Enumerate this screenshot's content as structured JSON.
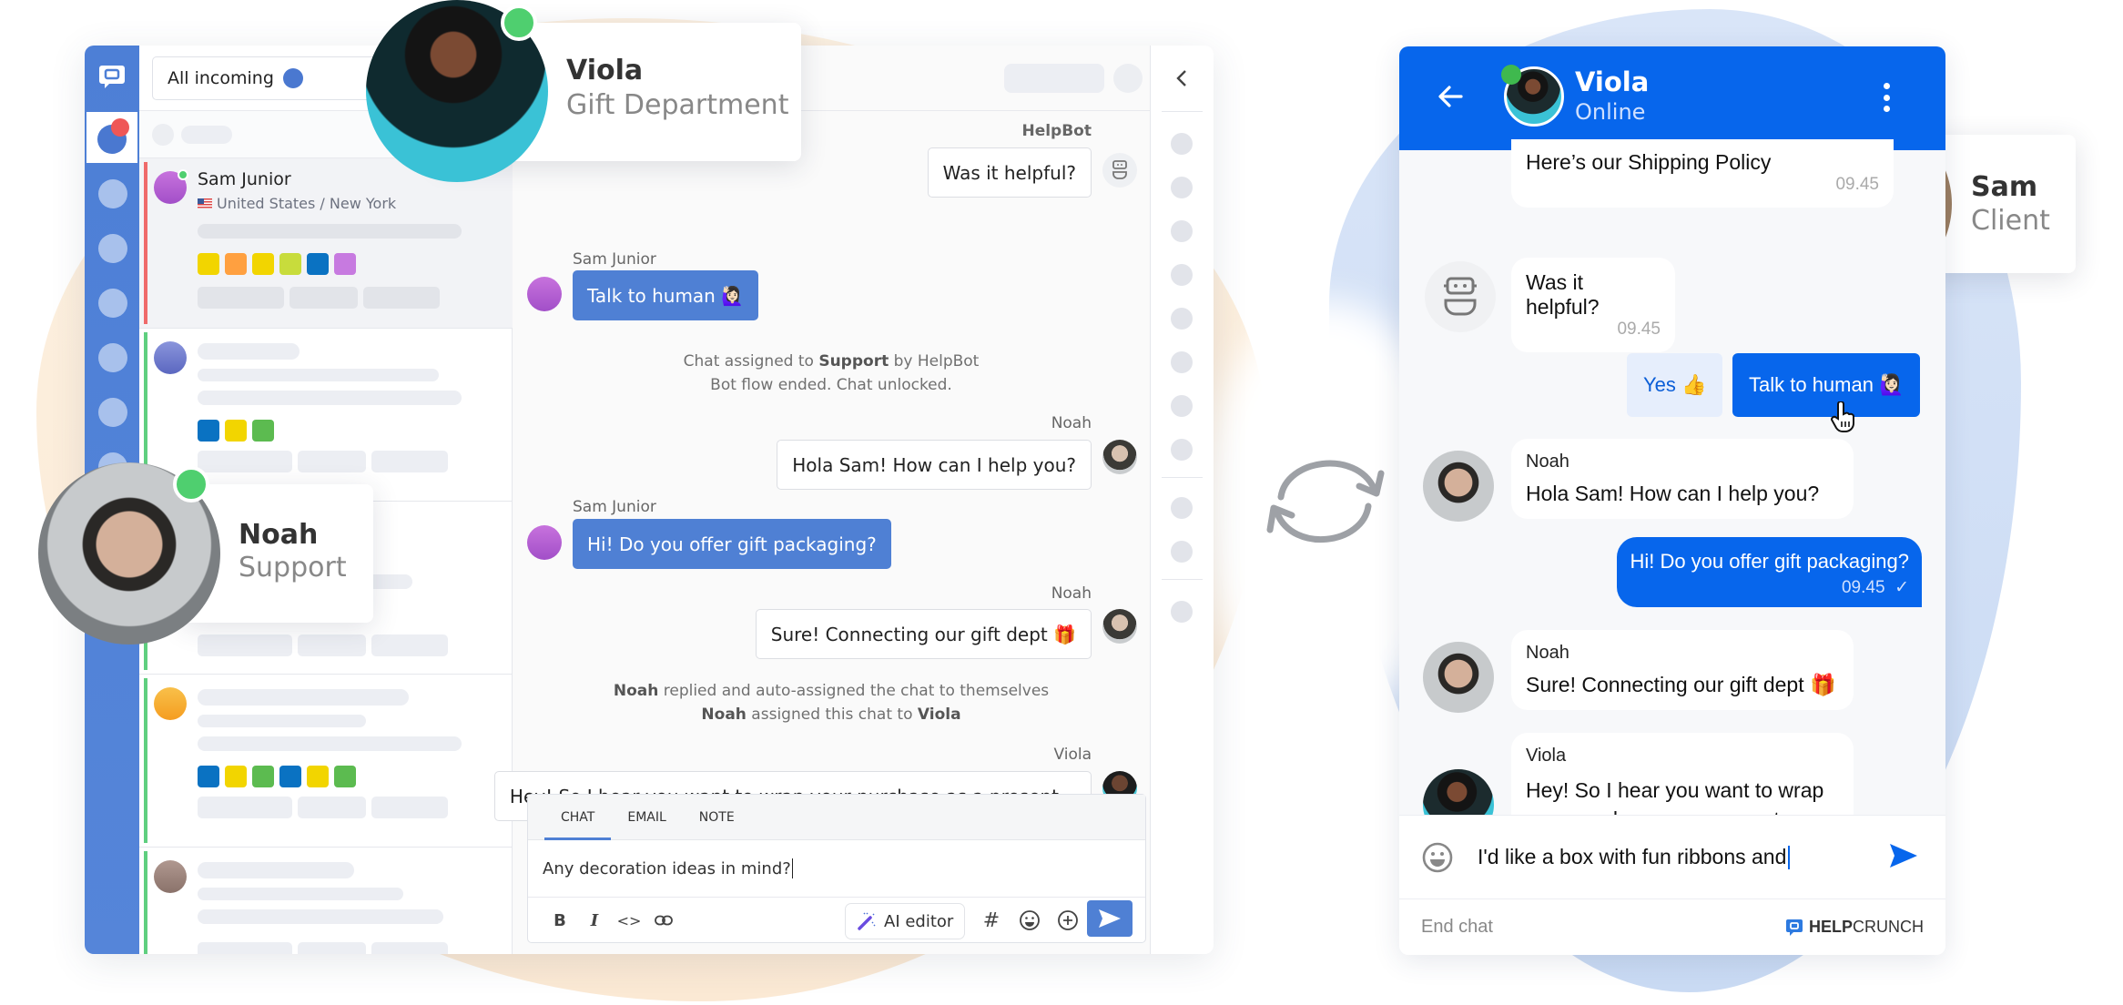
{
  "agent_app": {
    "filter": {
      "label": "All incoming"
    },
    "conversations": [
      {
        "name": "Sam Junior",
        "location": "United States / New York",
        "stripe_color": "#ef6a6a",
        "avatar_color": "#b45cd6",
        "online": true,
        "tags": [
          "#f2d500",
          "#ffa040",
          "#f2d500",
          "#c8dc3c",
          "#0a72c2",
          "#c77ae0"
        ]
      },
      {
        "stripe_color": "#5fcf7f",
        "avatar_color": "#6f7fd0",
        "tags": [
          "#0a72c2",
          "#f2d500",
          "#5cbb50"
        ]
      },
      {
        "stripe_color": "#5fcf7f",
        "avatar_color": "#a0a8c0",
        "tags": []
      },
      {
        "stripe_color": "#5fcf7f",
        "avatar_color": "#f6a628",
        "tags": [
          "#0a72c2",
          "#f2d500",
          "#5cbb50",
          "#0a72c2",
          "#f2d500",
          "#5cbb50"
        ]
      },
      {
        "stripe_color": "#5fcf7f",
        "avatar_color": "#9d847a",
        "tags": []
      }
    ],
    "chat": {
      "messages": [
        {
          "sender": "HelpBot",
          "text": "Was it helpful?",
          "direction": "out"
        },
        {
          "sender": "Sam Junior",
          "text": "Talk to human 🙋🏻‍♀️",
          "direction": "in"
        },
        {
          "sender": "Noah",
          "text": "Hola Sam! How can I help you?",
          "direction": "out"
        },
        {
          "sender": "Sam Junior",
          "text": "Hi! Do you offer gift packaging?",
          "direction": "in"
        },
        {
          "sender": "Noah",
          "text": "Sure! Connecting our gift dept 🎁",
          "direction": "out"
        },
        {
          "sender": "Viola",
          "text": "Hey! So I hear you want to wrap your purchase as a present...",
          "direction": "out"
        }
      ],
      "system_1": {
        "prefix": "Chat assigned to ",
        "bold": "Support",
        "suffix": " by HelpBot",
        "line2": "Bot flow ended. Chat unlocked."
      },
      "system_2": {
        "line1_bold": "Noah",
        "line1_rest": " replied and auto-assigned the chat to themselves",
        "line2_bold1": "Noah",
        "line2_mid": " assigned this chat to ",
        "line2_bold2": "Viola"
      }
    },
    "composer": {
      "tabs": [
        "CHAT",
        "EMAIL",
        "NOTE"
      ],
      "active_tab": "CHAT",
      "value": "Any decoration ideas in mind?",
      "tools": {
        "bold": "B",
        "italic": "I",
        "code": "<>",
        "ai_editor": "AI editor",
        "hash": "#"
      }
    }
  },
  "profiles": {
    "viola": {
      "name": "Viola",
      "role": "Gift Department",
      "status_color": "#4fcf6f"
    },
    "noah": {
      "name": "Noah",
      "role": "Support",
      "status_color": "#4fcf6f"
    },
    "sam": {
      "name": "Sam",
      "role": "Client",
      "status_color": "#c063d8"
    }
  },
  "widget": {
    "header": {
      "name": "Viola",
      "status": "Online"
    },
    "messages": {
      "shipping": {
        "text": "Here’s our Shipping Policy",
        "time": "09.45"
      },
      "helpful": {
        "text": "Was it helpful?",
        "time": "09.45"
      },
      "choice_yes": "Yes 👍",
      "choice_human": "Talk to human 🙋🏻‍♀️",
      "noah_1": {
        "sender": "Noah",
        "text": "Hola Sam! How can I help you?"
      },
      "sam_1": {
        "text": "Hi! Do you offer gift packaging?",
        "time": "09.45"
      },
      "noah_2": {
        "sender": "Noah",
        "text": "Sure! Connecting our gift dept 🎁"
      },
      "viola_1": {
        "sender": "Viola",
        "line1": "Hey! So I hear you want to wrap",
        "line2": "your purchase as a present..."
      }
    },
    "input": {
      "value": "I'd like a box with fun ribbons and"
    },
    "footer": {
      "end_chat": "End chat",
      "brand_bold": "HELP",
      "brand_rest": "CRUNCH"
    }
  },
  "colors": {
    "agent_blue": "#4f80d4",
    "widget_blue": "#0766ec",
    "online_green": "#4fcf6f"
  }
}
